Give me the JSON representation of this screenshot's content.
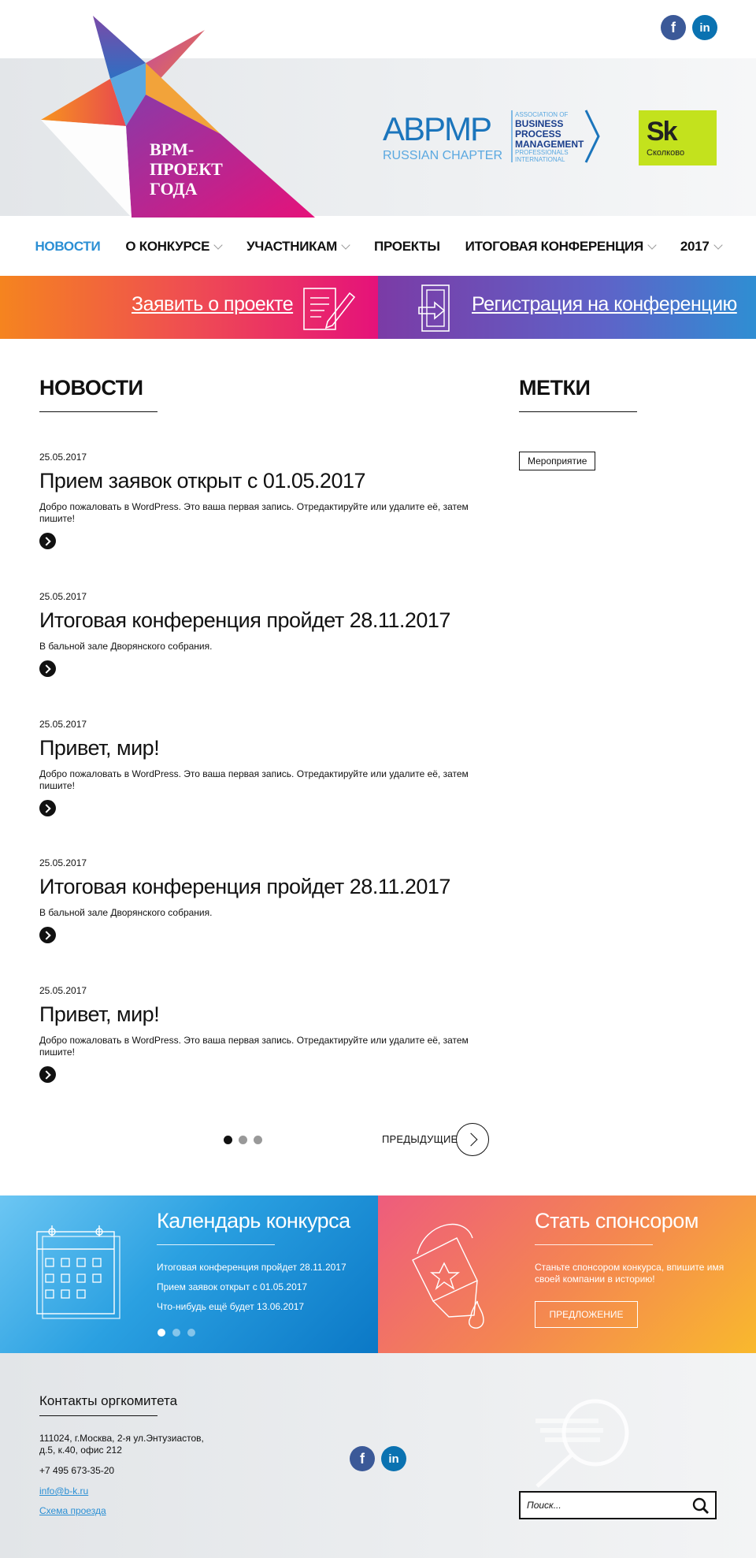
{
  "social": {
    "facebook_icon": "facebook-icon",
    "linkedin_icon": "linkedin-icon"
  },
  "brand": {
    "logo_lines": [
      "BPM-",
      "ПРОЕКТ",
      "ГОДА"
    ],
    "abpmp": {
      "main": "ABPMP",
      "chapter": "RUSSIAN CHAPTER",
      "assoc1": "ASSOCIATION OF",
      "assoc2": "BUSINESS",
      "assoc3": "PROCESS",
      "assoc4": "MANAGEMENT",
      "assoc5": "PROFESSIONALS",
      "assoc6": "INTERNATIONAL"
    },
    "skolkovo": {
      "mark": "Sk",
      "name": "Сколково"
    }
  },
  "nav": [
    {
      "label": "НОВОСТИ",
      "active": true,
      "dropdown": false
    },
    {
      "label": "О КОНКУРСЕ",
      "active": false,
      "dropdown": true
    },
    {
      "label": "УЧАСТНИКАМ",
      "active": false,
      "dropdown": true
    },
    {
      "label": "ПРОЕКТЫ",
      "active": false,
      "dropdown": false
    },
    {
      "label": "ИТОГОВАЯ КОНФЕРЕНЦИЯ",
      "active": false,
      "dropdown": true
    },
    {
      "label": "2017",
      "active": false,
      "dropdown": true
    }
  ],
  "cta": {
    "apply": "Заявить о проекте",
    "register": "Регистрация на конференцию"
  },
  "news": {
    "heading": "НОВОСТИ",
    "items": [
      {
        "date": "25.05.2017",
        "title": "Прием заявок открыт с 01.05.2017",
        "excerpt": "Добро пожаловать в WordPress. Это ваша первая запись. Отредактируйте или удалите её, затем пишите!"
      },
      {
        "date": "25.05.2017",
        "title": "Итоговая конференция пройдет 28.11.2017",
        "excerpt": "В бальной зале Дворянского собрания."
      },
      {
        "date": "25.05.2017",
        "title": "Привет, мир!",
        "excerpt": "Добро пожаловать в WordPress. Это ваша первая запись. Отредактируйте или удалите её, затем пишите!"
      },
      {
        "date": "25.05.2017",
        "title": "Итоговая конференция пройдет 28.11.2017",
        "excerpt": "В бальной зале Дворянского собрания."
      },
      {
        "date": "25.05.2017",
        "title": "Привет, мир!",
        "excerpt": "Добро пожаловать в WordPress. Это ваша первая запись. Отредактируйте или удалите её, затем пишите!"
      }
    ],
    "pagination": {
      "prev_label": "ПРЕДЫДУЩИЕ",
      "active_page": 1,
      "pages": 3
    }
  },
  "tags": {
    "heading": "МЕТКИ",
    "items": [
      "Мероприятие"
    ]
  },
  "calendar": {
    "title": "Календарь конкурса",
    "events": [
      "Итоговая конференция пройдет 28.11.2017",
      "Прием заявок открыт с 01.05.2017",
      "Что-нибудь ещё будет 13.06.2017"
    ],
    "slide_active": 1,
    "slides": 3
  },
  "sponsor": {
    "title": "Стать спонсором",
    "text_line1": "Станьте спонсором конкурса, впишите имя",
    "text_line2": "своей компании в историю!",
    "button": "ПРЕДЛОЖЕНИЕ"
  },
  "footer": {
    "title": "Контакты оргкомитета",
    "address_line1": "111024, г.Москва, 2-я ул.Энтузиастов,",
    "address_line2": "д.5, к.40, офис 212",
    "phone": "+7 495 673-35-20",
    "email": "info@b-k.ru",
    "map_link": "Схема проезда",
    "search_placeholder": "Поиск..."
  },
  "colors": {
    "accent_blue": "#2b8fd4",
    "facebook": "#3b5998",
    "linkedin": "#0a72b1",
    "skolkovo": "#c3e21d"
  }
}
